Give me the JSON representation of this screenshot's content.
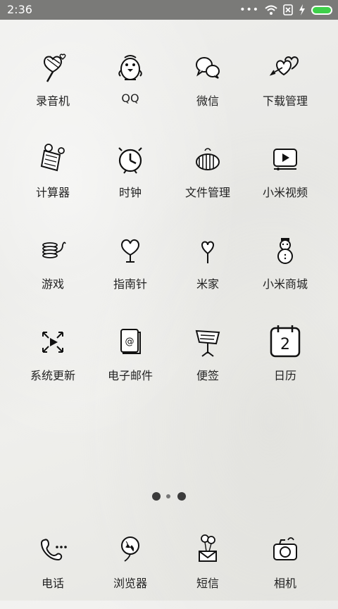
{
  "status_bar": {
    "time": "2:36"
  },
  "apps": [
    {
      "label": "录音机",
      "icon": "microphone-icon"
    },
    {
      "label": "QQ",
      "icon": "qq-penguin-icon"
    },
    {
      "label": "微信",
      "icon": "wechat-bubbles-icon"
    },
    {
      "label": "下载管理",
      "icon": "download-hearts-icon"
    },
    {
      "label": "计算器",
      "icon": "calculator-icon"
    },
    {
      "label": "时钟",
      "icon": "alarm-clock-icon"
    },
    {
      "label": "文件管理",
      "icon": "file-folder-icon"
    },
    {
      "label": "小米视频",
      "icon": "video-play-icon"
    },
    {
      "label": "游戏",
      "icon": "slinky-game-icon"
    },
    {
      "label": "指南针",
      "icon": "heart-compass-icon"
    },
    {
      "label": "米家",
      "icon": "lollipop-home-icon"
    },
    {
      "label": "小米商城",
      "icon": "snowman-store-icon"
    },
    {
      "label": "系统更新",
      "icon": "update-arrows-icon"
    },
    {
      "label": "电子邮件",
      "icon": "email-book-icon"
    },
    {
      "label": "便签",
      "icon": "music-stand-notes-icon"
    },
    {
      "label": "日历",
      "icon": "calendar-icon",
      "calendar_day": "2"
    }
  ],
  "dock": [
    {
      "label": "电话",
      "icon": "phone-icon"
    },
    {
      "label": "浏览器",
      "icon": "globe-balloon-icon"
    },
    {
      "label": "短信",
      "icon": "mail-balloons-icon"
    },
    {
      "label": "相机",
      "icon": "camera-icon"
    }
  ],
  "pager": {
    "pages": 3,
    "current": 2
  }
}
